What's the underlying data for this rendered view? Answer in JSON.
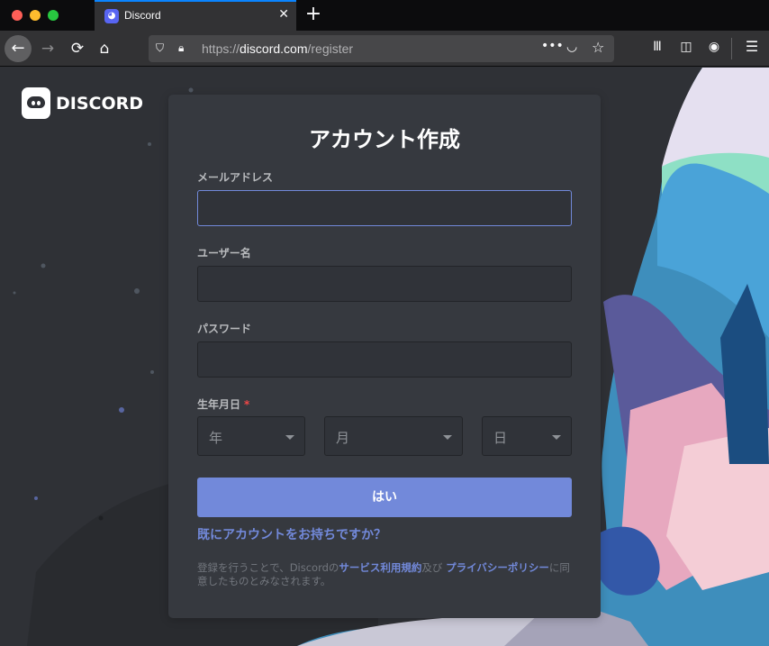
{
  "browser": {
    "tab_title": "Discord",
    "tab_close": "✕",
    "new_tab": "+",
    "url_prefix": "https://",
    "url_host": "discord.com",
    "url_path": "/register",
    "more": "•••"
  },
  "brand": {
    "logo_text": "DISCORD"
  },
  "form": {
    "title": "アカウント作成",
    "email_label": "メールアドレス",
    "username_label": "ユーザー名",
    "password_label": "パスワード",
    "dob_label": "生年月日",
    "required_mark": "*",
    "year_placeholder": "年",
    "month_placeholder": "月",
    "day_placeholder": "日",
    "submit_label": "はい",
    "login_link": "既にアカウントをお持ちですか？",
    "legal_prefix": "登録を行うことで、Discordの",
    "tos_link": "サービス利用規約",
    "legal_and": "及び",
    "privacy_link": "プライバシーポリシー",
    "legal_suffix": "に同意したものとみなされます。"
  },
  "colors": {
    "accent": "#7289da",
    "card_bg": "#36393f",
    "page_bg": "#2f3136",
    "required": "#f04747"
  }
}
